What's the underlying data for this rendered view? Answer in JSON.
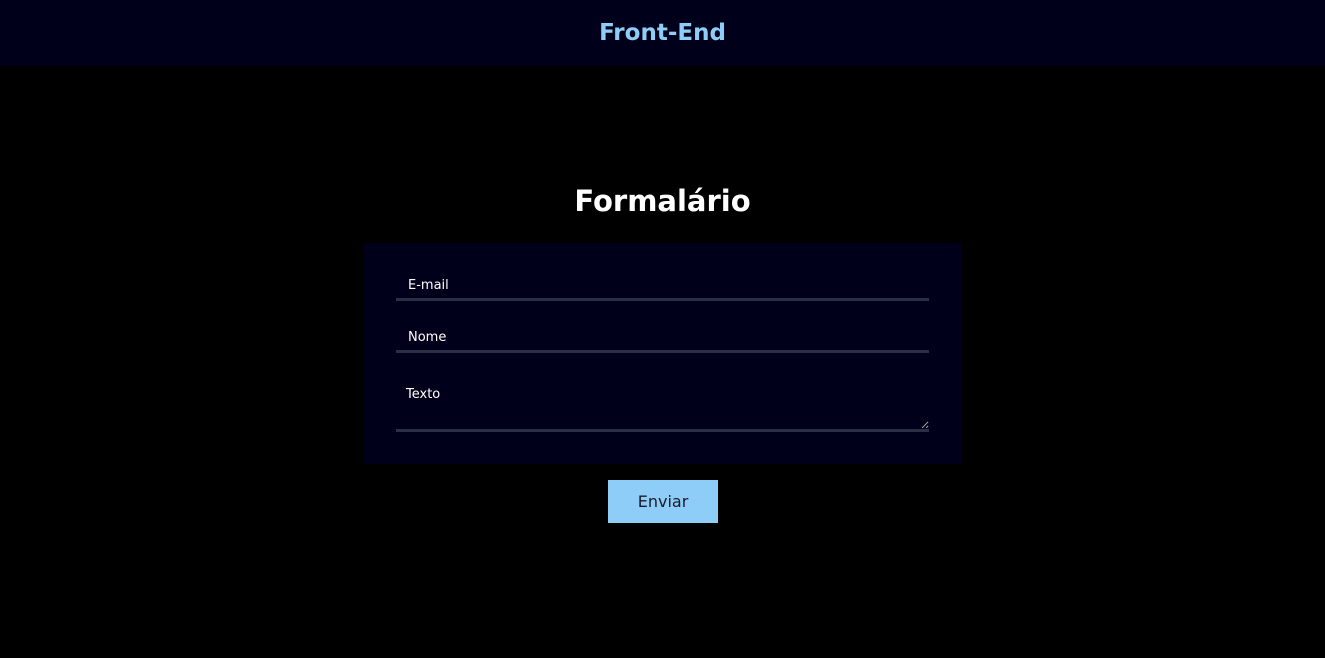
{
  "header": {
    "brand": "Front-End"
  },
  "form": {
    "title": "Formalário",
    "email": {
      "placeholder": "E-mail",
      "value": ""
    },
    "name": {
      "placeholder": "Nome",
      "value": ""
    },
    "text": {
      "placeholder": "Texto",
      "value": ""
    },
    "submit_label": "Enviar"
  },
  "colors": {
    "page_background": "#000000",
    "panel_background": "#00001a",
    "accent": "#8ecdf7",
    "field_underline": "#2a2f45"
  }
}
